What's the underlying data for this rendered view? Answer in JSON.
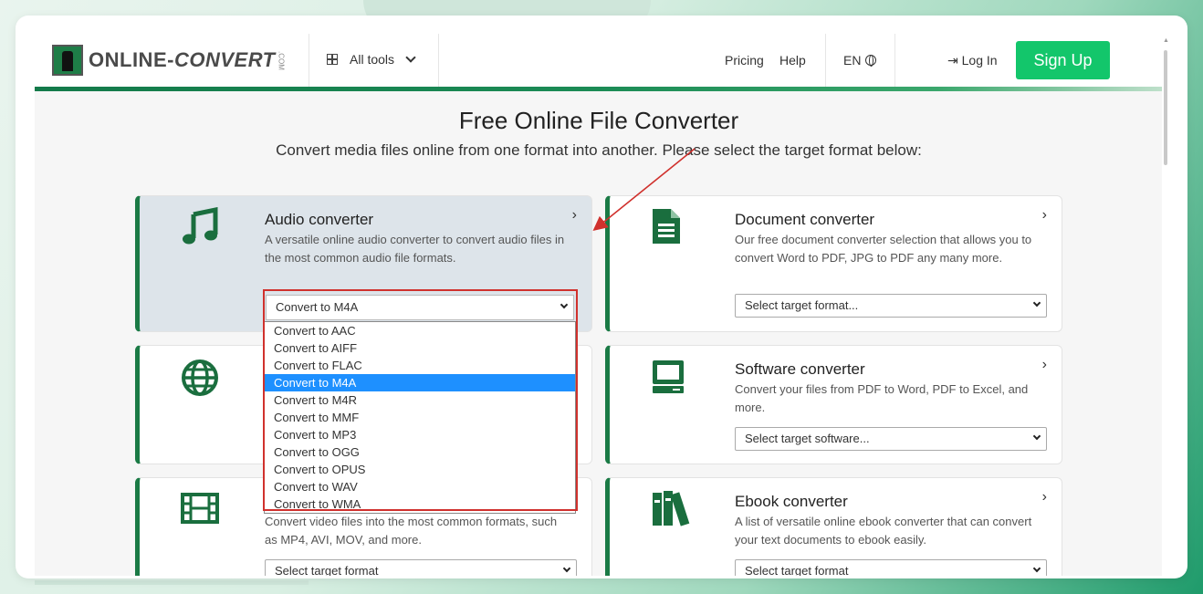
{
  "brand": {
    "logo_text": "ONLINE-",
    "logo_text2": "CONVERT",
    "logo_com": ".COM"
  },
  "nav": {
    "all_tools": "All tools",
    "pricing": "Pricing",
    "help": "Help",
    "language": "EN",
    "login": "Log In",
    "signup": "Sign Up"
  },
  "hero": {
    "title": "Free Online File Converter",
    "subtitle": "Convert media files online from one format into another. Please select the target format below:"
  },
  "cards": {
    "audio": {
      "title": "Audio converter",
      "desc": "A versatile online audio converter to convert audio files in the most common audio file formats.",
      "selected": "Convert to M4A"
    },
    "document": {
      "title": "Document converter",
      "desc": "Our free document converter selection that allows you to convert Word to PDF, JPG to PDF any many more.",
      "placeholder": "Select target format..."
    },
    "software": {
      "title": "Software converter",
      "desc": "Convert your files from PDF to Word, PDF to Excel, and more.",
      "placeholder": "Select target software..."
    },
    "video": {
      "desc": "Convert video files into the most common formats, such as MP4, AVI, MOV, and more.",
      "placeholder": "Select target format"
    },
    "ebook": {
      "title": "Ebook converter",
      "desc": "A list of versatile online ebook converter that can convert your text documents to ebook easily.",
      "placeholder": "Select target format"
    }
  },
  "dropdown_options": [
    "Convert to AAC",
    "Convert to AIFF",
    "Convert to FLAC",
    "Convert to M4A",
    "Convert to M4R",
    "Convert to MMF",
    "Convert to MP3",
    "Convert to OGG",
    "Convert to OPUS",
    "Convert to WAV",
    "Convert to WMA"
  ],
  "highlighted_option": "Convert to M4A",
  "colors": {
    "brand_green": "#1a7a45",
    "signup_green": "#13c66b",
    "highlight_blue": "#1e90ff",
    "annotation_red": "#d0312d"
  }
}
